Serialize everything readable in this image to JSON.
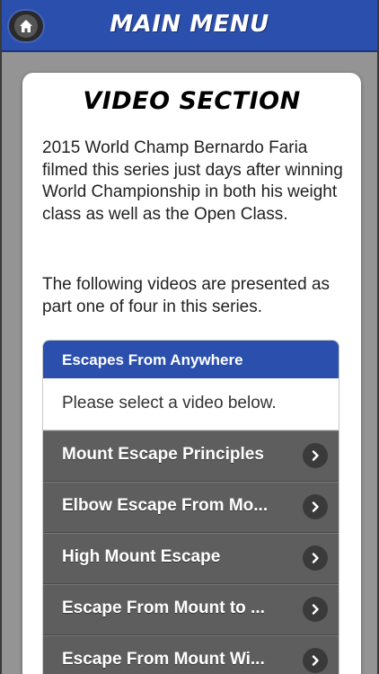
{
  "header": {
    "title": "MAIN MENU",
    "home_icon": "home-icon"
  },
  "card": {
    "title": "VIDEO SECTION",
    "paragraph1": "2015 World Champ Bernardo Faria filmed this series just days after winning World Championship in both his weight class as well as the Open Class.",
    "paragraph2": "The following videos are presented as part one of four in this series."
  },
  "list": {
    "header": "Escapes From Anywhere",
    "subheader": "Please select a video below.",
    "items": [
      {
        "label": "Mount Escape Principles"
      },
      {
        "label": "Elbow Escape From Mo..."
      },
      {
        "label": "High Mount Escape"
      },
      {
        "label": "Escape From Mount to ..."
      },
      {
        "label": "Escape From Mount Wi..."
      }
    ],
    "chevron_icon": "chevron-right-icon"
  },
  "colors": {
    "header_bg": "#2b4fad",
    "page_bg": "#949494",
    "item_bg": "#5e5e5e"
  }
}
